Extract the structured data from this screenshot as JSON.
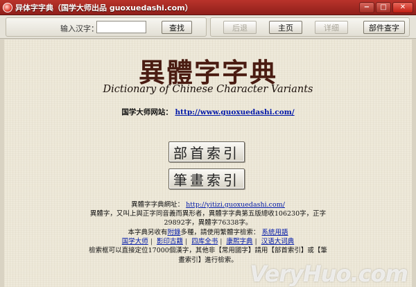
{
  "window": {
    "title": "异体字字典（国学大师出品 guoxuedashi.com）",
    "controls": [
      "−",
      "□",
      "✕"
    ]
  },
  "toolbar": {
    "search_label": "输入汉字：",
    "search_value": "",
    "search_button": "查找",
    "back_button": "后退",
    "home_button": "主页",
    "forward_button": "详细",
    "radical_button": "部件查字"
  },
  "main": {
    "logo_cn": "異體字字典",
    "logo_en": "Dictionary of Chinese Character Variants",
    "site_label": "国学大师网站：",
    "site_url": "http://www.guoxuedashi.com/",
    "index_buttons": {
      "radical": "部首索引",
      "stroke": "筆畫索引"
    },
    "info": {
      "url_label": "異體字字典網址：",
      "url": "http://yitizi.guoxuedashi.com/",
      "desc_1": "異體字，又叫上與正字同音義而異形者，異體字字典第五版總收106230字，正字",
      "desc_2": "29892字，異體字76338字。",
      "other_prefix": "本字典另收有",
      "other_link": "附錄",
      "other_middle": "多種，請使用繁體字檢索：",
      "other_sys": "系統用語",
      "links": [
        "国学大师",
        "影印古籍",
        "四库全书",
        "康熙字典",
        "汉语大词典"
      ],
      "search_1": "檢索框可以直接定位17000個漢字，其他非【常用國字】請用【部首索引】或【筆",
      "search_2": "畫索引】進行檢索。"
    }
  },
  "watermark": "VeryHuo.com",
  "colors": {
    "titlebar": "#9e251e",
    "link": "#0018a8",
    "logo": "#4a1c12",
    "background": "#eee9da"
  }
}
